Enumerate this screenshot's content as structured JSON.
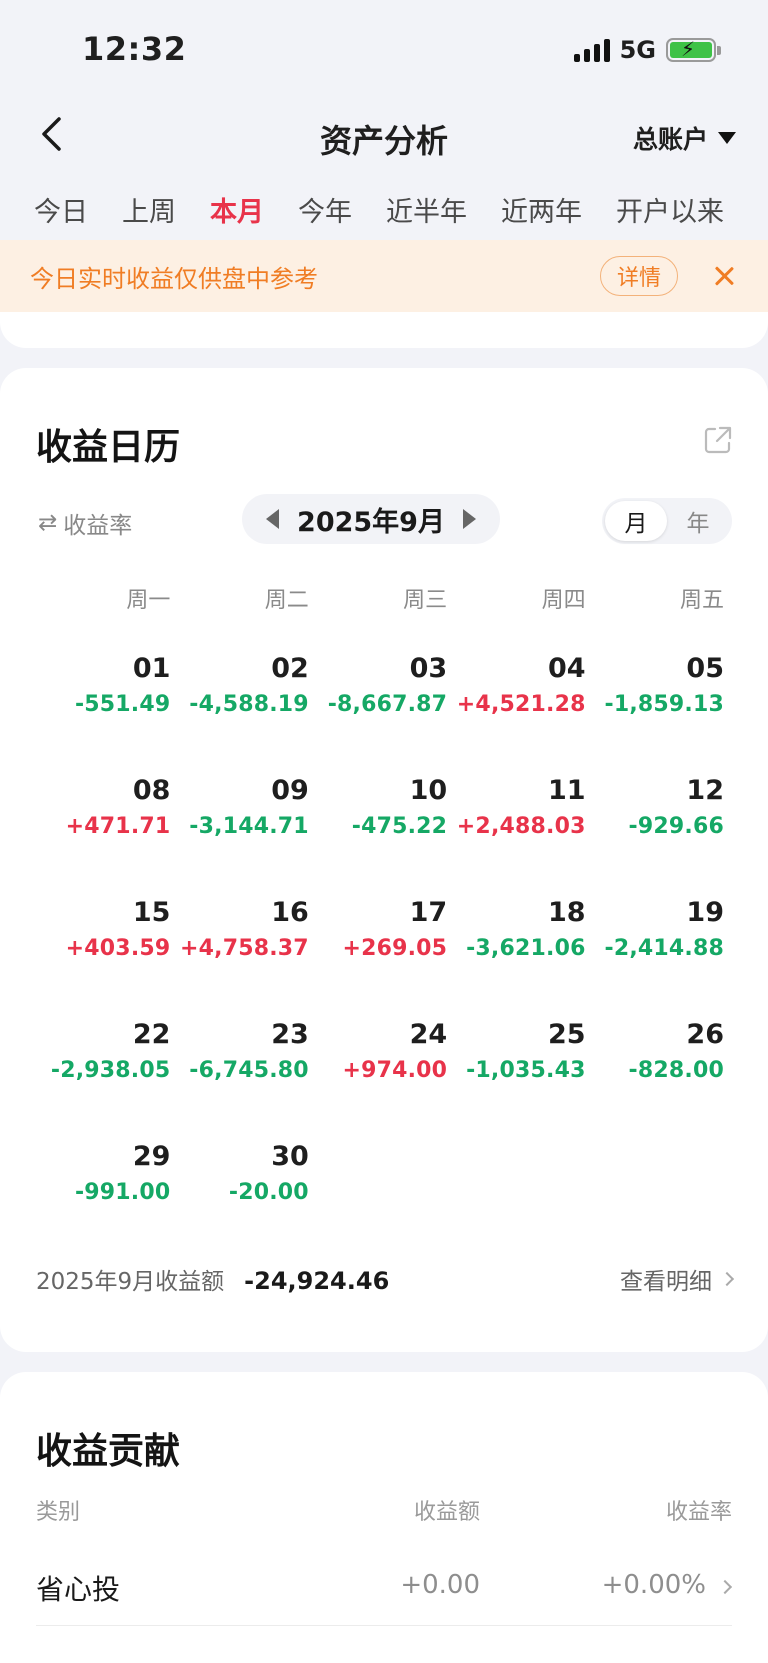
{
  "status": {
    "time": "12:32",
    "network": "5G"
  },
  "nav": {
    "title": "资产分析",
    "account": "总账户"
  },
  "period_tabs": [
    "今日",
    "上周",
    "本月",
    "今年",
    "近半年",
    "近两年",
    "开户以来"
  ],
  "active_period": "本月",
  "notice": {
    "text": "今日实时收益仅供盘中参考",
    "detail": "详情"
  },
  "calendar": {
    "title": "收益日历",
    "rate_toggle": "收益率",
    "month": "2025年9月",
    "view_options": [
      "月",
      "年"
    ],
    "weekdays": [
      "周一",
      "周二",
      "周三",
      "周四",
      "周五"
    ],
    "days": [
      {
        "day": "01",
        "value": "-551.49"
      },
      {
        "day": "02",
        "value": "-4,588.19"
      },
      {
        "day": "03",
        "value": "-8,667.87"
      },
      {
        "day": "04",
        "value": "+4,521.28"
      },
      {
        "day": "05",
        "value": "-1,859.13"
      },
      {
        "day": "08",
        "value": "+471.71"
      },
      {
        "day": "09",
        "value": "-3,144.71"
      },
      {
        "day": "10",
        "value": "-475.22"
      },
      {
        "day": "11",
        "value": "+2,488.03"
      },
      {
        "day": "12",
        "value": "-929.66"
      },
      {
        "day": "15",
        "value": "+403.59"
      },
      {
        "day": "16",
        "value": "+4,758.37"
      },
      {
        "day": "17",
        "value": "+269.05"
      },
      {
        "day": "18",
        "value": "-3,621.06"
      },
      {
        "day": "19",
        "value": "-2,414.88"
      },
      {
        "day": "22",
        "value": "-2,938.05"
      },
      {
        "day": "23",
        "value": "-6,745.80"
      },
      {
        "day": "24",
        "value": "+974.00"
      },
      {
        "day": "25",
        "value": "-1,035.43"
      },
      {
        "day": "26",
        "value": "-828.00"
      },
      {
        "day": "29",
        "value": "-991.00"
      },
      {
        "day": "30",
        "value": "-20.00"
      }
    ],
    "summary_label": "2025年9月收益额",
    "summary_value": "-24,924.46",
    "detail_link": "查看明细"
  },
  "contribution": {
    "title": "收益贡献",
    "headers": {
      "name": "类别",
      "amount": "收益额",
      "rate": "收益率"
    },
    "rows": [
      {
        "name": "省心投",
        "amount": "+0.00",
        "rate": "+0.00%"
      }
    ]
  },
  "colors": {
    "positive": "#e8334a",
    "negative": "#15a865",
    "accent": "#e8334a",
    "notice": "#f07d24"
  }
}
